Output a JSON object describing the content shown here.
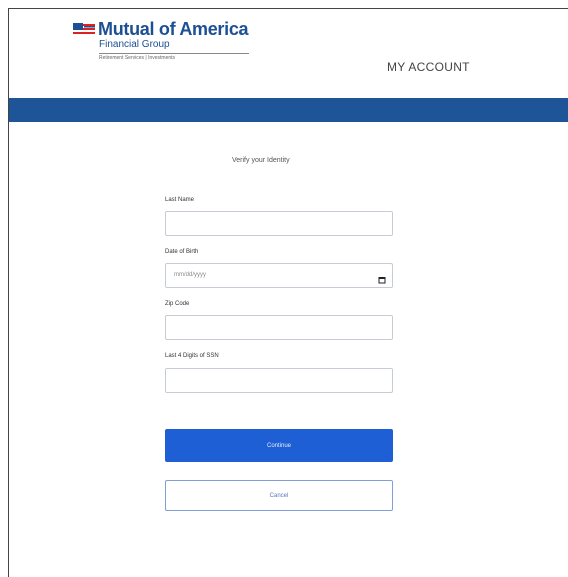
{
  "header": {
    "brand_name": "Mutual of America",
    "brand_sub": "Financial Group",
    "brand_tagline": "Retirement Services | Investments",
    "my_account": "MY ACCOUNT"
  },
  "colors": {
    "brand": "#1c4f93",
    "banner": "#1e5598",
    "primary_button": "#1f5fd6"
  },
  "form": {
    "title": "Verify your Identity",
    "last_name_label": "Last Name",
    "last_name_value": "",
    "dob_label": "Date of Birth",
    "dob_placeholder": "mm/dd/yyyy",
    "zip_label": "Zip Code",
    "zip_value": "",
    "ssn_label": "Last 4 Digits of SSN",
    "ssn_value": "",
    "continue_label": "Continue",
    "cancel_label": "Cancel"
  },
  "icons": {
    "logo": "flag-icon",
    "date_picker": "calendar-icon"
  }
}
